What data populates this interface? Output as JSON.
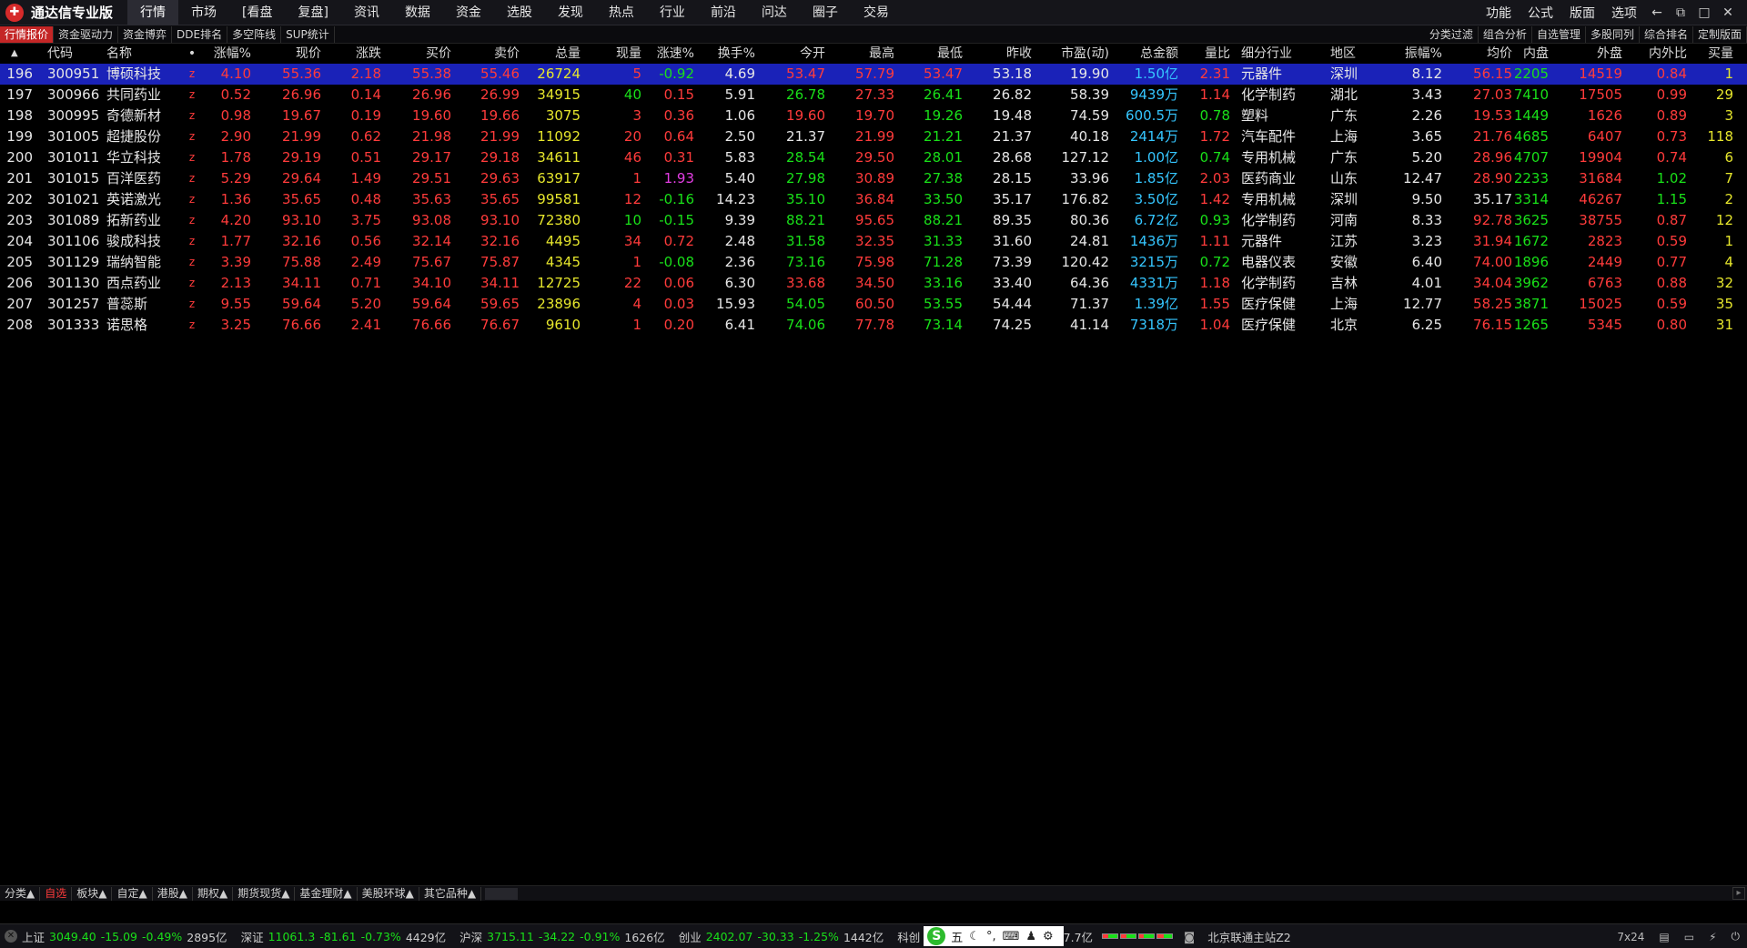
{
  "app": {
    "title": "通达信专业版"
  },
  "menu": [
    "行情",
    "市场",
    "[看盘",
    "复盘]",
    "资讯",
    "数据",
    "资金",
    "选股",
    "发现",
    "热点",
    "行业",
    "前沿",
    "问达",
    "圈子",
    "交易"
  ],
  "menu_active": 0,
  "right_menu": [
    "功能",
    "公式",
    "版面",
    "选项"
  ],
  "window_controls": [
    "back-icon",
    "restore-icon",
    "maximize-icon",
    "close-icon"
  ],
  "subtabs": [
    "行情报价",
    "资金驱动力",
    "资金博弈",
    "DDE排名",
    "多空阵线",
    "SUP统计"
  ],
  "subtabs_right": [
    "分类过滤",
    "组合分析",
    "自选管理",
    "多股同列",
    "综合排名",
    "定制版面"
  ],
  "table": {
    "headers": [
      "",
      "代码",
      "名称",
      "•",
      "涨幅%",
      "现价",
      "涨跌",
      "买价",
      "卖价",
      "总量",
      "现量",
      "涨速%",
      "换手%",
      "今开",
      "最高",
      "最低",
      "昨收",
      "市盈(动)",
      "总金额",
      "量比",
      "细分行业",
      "地区",
      "振幅%",
      "均价",
      "内盘",
      "外盘",
      "内外比",
      "买量"
    ],
    "rows": [
      [
        "196",
        "300951",
        "博硕科技",
        "z",
        "4.10",
        "55.36",
        "2.18",
        "55.38",
        "55.46",
        "26724",
        "5",
        "-0.92",
        "4.69",
        "53.47",
        "57.79",
        "53.47",
        "53.18",
        "19.90",
        "1.50亿",
        "2.31",
        "元器件",
        "深圳",
        "8.12",
        "56.15",
        "2205",
        "14519",
        "0.84",
        "1"
      ],
      [
        "197",
        "300966",
        "共同药业",
        "z",
        "0.52",
        "26.96",
        "0.14",
        "26.96",
        "26.99",
        "34915",
        "40",
        "0.15",
        "5.91",
        "26.78",
        "27.33",
        "26.41",
        "26.82",
        "58.39",
        "9439万",
        "1.14",
        "化学制药",
        "湖北",
        "3.43",
        "27.03",
        "7410",
        "17505",
        "0.99",
        "29"
      ],
      [
        "198",
        "300995",
        "奇德新材",
        "z",
        "0.98",
        "19.67",
        "0.19",
        "19.60",
        "19.66",
        "3075",
        "3",
        "0.36",
        "1.06",
        "19.60",
        "19.70",
        "19.26",
        "19.48",
        "74.59",
        "600.5万",
        "0.78",
        "塑料",
        "广东",
        "2.26",
        "19.53",
        "1449",
        "1626",
        "0.89",
        "3"
      ],
      [
        "199",
        "301005",
        "超捷股份",
        "z",
        "2.90",
        "21.99",
        "0.62",
        "21.98",
        "21.99",
        "11092",
        "20",
        "0.64",
        "2.50",
        "21.37",
        "21.99",
        "21.21",
        "21.37",
        "40.18",
        "2414万",
        "1.72",
        "汽车配件",
        "上海",
        "3.65",
        "21.76",
        "4685",
        "6407",
        "0.73",
        "118"
      ],
      [
        "200",
        "301011",
        "华立科技",
        "z",
        "1.78",
        "29.19",
        "0.51",
        "29.17",
        "29.18",
        "34611",
        "46",
        "0.31",
        "5.83",
        "28.54",
        "29.50",
        "28.01",
        "28.68",
        "127.12",
        "1.00亿",
        "0.74",
        "专用机械",
        "广东",
        "5.20",
        "28.96",
        "4707",
        "19904",
        "0.74",
        "6"
      ],
      [
        "201",
        "301015",
        "百洋医药",
        "z",
        "5.29",
        "29.64",
        "1.49",
        "29.51",
        "29.63",
        "63917",
        "1",
        "1.93",
        "5.40",
        "27.98",
        "30.89",
        "27.38",
        "28.15",
        "33.96",
        "1.85亿",
        "2.03",
        "医药商业",
        "山东",
        "12.47",
        "28.90",
        "2233",
        "31684",
        "1.02",
        "7"
      ],
      [
        "202",
        "301021",
        "英诺激光",
        "z",
        "1.36",
        "35.65",
        "0.48",
        "35.63",
        "35.65",
        "99581",
        "12",
        "-0.16",
        "14.23",
        "35.10",
        "36.84",
        "33.50",
        "35.17",
        "176.82",
        "3.50亿",
        "1.42",
        "专用机械",
        "深圳",
        "9.50",
        "35.17",
        "3314",
        "46267",
        "1.15",
        "2"
      ],
      [
        "203",
        "301089",
        "拓新药业",
        "z",
        "4.20",
        "93.10",
        "3.75",
        "93.08",
        "93.10",
        "72380",
        "10",
        "-0.15",
        "9.39",
        "88.21",
        "95.65",
        "88.21",
        "89.35",
        "80.36",
        "6.72亿",
        "0.93",
        "化学制药",
        "河南",
        "8.33",
        "92.78",
        "3625",
        "38755",
        "0.87",
        "12"
      ],
      [
        "204",
        "301106",
        "骏成科技",
        "z",
        "1.77",
        "32.16",
        "0.56",
        "32.14",
        "32.16",
        "4495",
        "34",
        "0.72",
        "2.48",
        "31.58",
        "32.35",
        "31.33",
        "31.60",
        "24.81",
        "1436万",
        "1.11",
        "元器件",
        "江苏",
        "3.23",
        "31.94",
        "1672",
        "2823",
        "0.59",
        "1"
      ],
      [
        "205",
        "301129",
        "瑞纳智能",
        "z",
        "3.39",
        "75.88",
        "2.49",
        "75.67",
        "75.87",
        "4345",
        "1",
        "-0.08",
        "2.36",
        "73.16",
        "75.98",
        "71.28",
        "73.39",
        "120.42",
        "3215万",
        "0.72",
        "电器仪表",
        "安徽",
        "6.40",
        "74.00",
        "1896",
        "2449",
        "0.77",
        "4"
      ],
      [
        "206",
        "301130",
        "西点药业",
        "z",
        "2.13",
        "34.11",
        "0.71",
        "34.10",
        "34.11",
        "12725",
        "22",
        "0.06",
        "6.30",
        "33.68",
        "34.50",
        "33.16",
        "33.40",
        "64.36",
        "4331万",
        "1.18",
        "化学制药",
        "吉林",
        "4.01",
        "34.04",
        "3962",
        "6763",
        "0.88",
        "32"
      ],
      [
        "207",
        "301257",
        "普蕊斯",
        "z",
        "9.55",
        "59.64",
        "5.20",
        "59.64",
        "59.65",
        "23896",
        "4",
        "0.03",
        "15.93",
        "54.05",
        "60.50",
        "53.55",
        "54.44",
        "71.37",
        "1.39亿",
        "1.55",
        "医疗保健",
        "上海",
        "12.77",
        "58.25",
        "3871",
        "15025",
        "0.59",
        "35"
      ],
      [
        "208",
        "301333",
        "诺思格",
        "z",
        "3.25",
        "76.66",
        "2.41",
        "76.66",
        "76.67",
        "9610",
        "1",
        "0.20",
        "6.41",
        "74.06",
        "77.78",
        "73.14",
        "74.25",
        "41.14",
        "7318万",
        "1.04",
        "医疗保健",
        "北京",
        "6.25",
        "76.15",
        "1265",
        "5345",
        "0.80",
        "31"
      ]
    ],
    "selected_row": 0
  },
  "bottom_tabs": [
    "分类▲",
    "自选",
    "板块▲",
    "自定▲",
    "港股▲",
    "期权▲",
    "期货现货▲",
    "基金理财▲",
    "美股环球▲",
    "其它品种▲"
  ],
  "bottom_active": 1,
  "status": {
    "indices": [
      {
        "name": "上证",
        "value": "3049.40",
        "change": "-15.09",
        "pct": "-0.49%",
        "amount": "2895亿"
      },
      {
        "name": "深证",
        "value": "11061.3",
        "change": "-81.61",
        "pct": "-0.73%",
        "amount": "4429亿"
      },
      {
        "name": "沪深",
        "value": "3715.11",
        "change": "-34.22",
        "pct": "-0.91%",
        "amount": "1626亿"
      },
      {
        "name": "创业",
        "value": "2402.07",
        "change": "-30.33",
        "pct": "-1.25%",
        "amount": "1442亿"
      }
    ],
    "partial_label": "科创",
    "ime": [
      "五",
      "☾",
      "°,",
      "⌨",
      "♟",
      "⚙"
    ],
    "after_ime": "7.7亿",
    "server": "北京联通主站Z2",
    "right": [
      "7x24"
    ]
  },
  "colors": {
    "up": "#ff3b3b",
    "down": "#19e019",
    "flat": "#e6e6e6",
    "volume": "#e6e62c",
    "amount": "#35c6ff",
    "select": "#1a22b8"
  }
}
